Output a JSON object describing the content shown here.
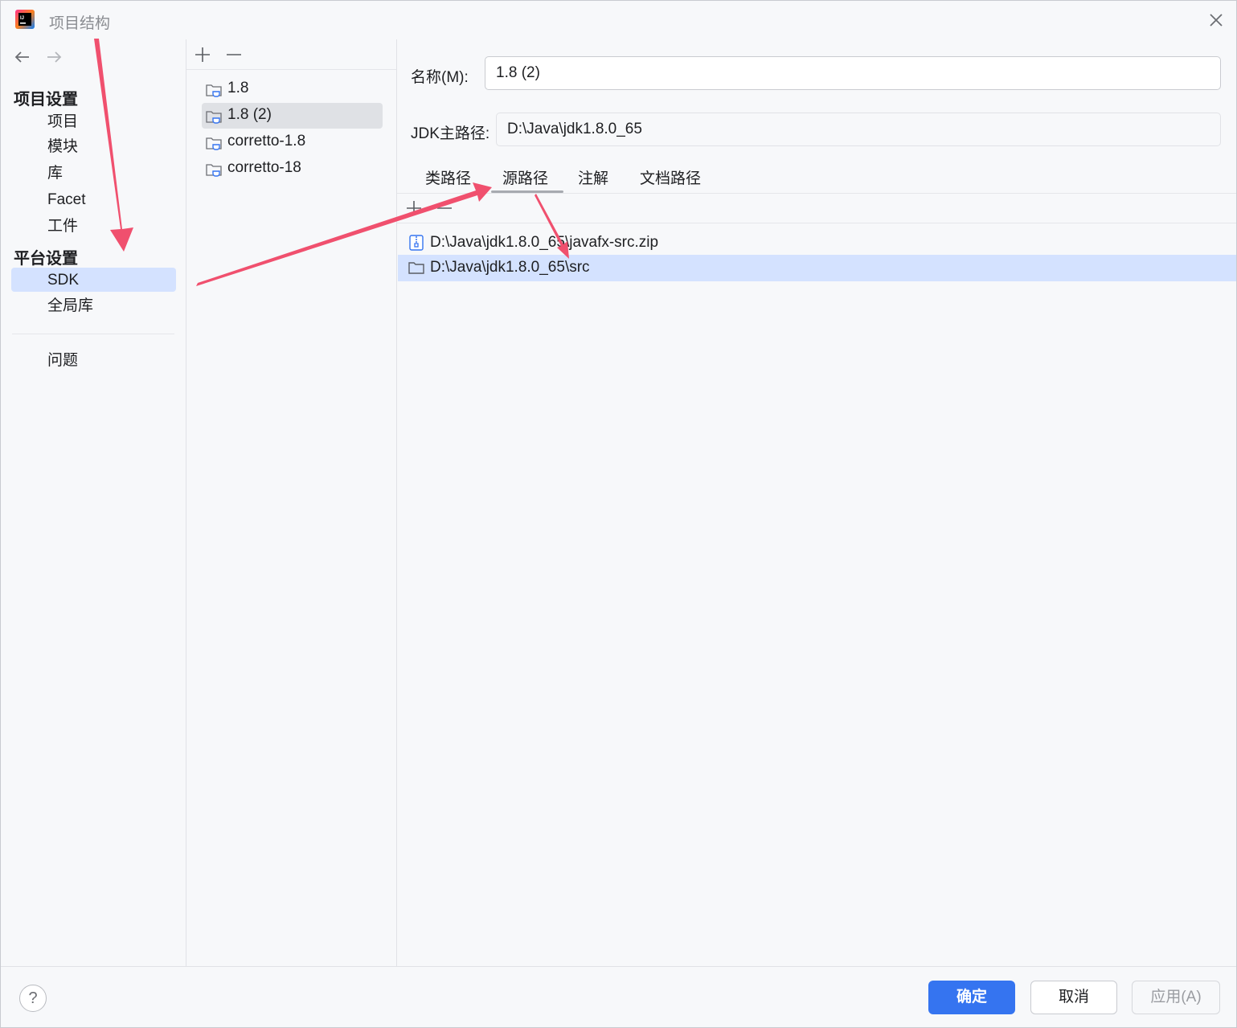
{
  "window": {
    "title": "项目结构"
  },
  "nav": {
    "project_settings": "项目设置",
    "project_items": [
      "项目",
      "模块",
      "库",
      "Facet",
      "工件"
    ],
    "platform_settings": "平台设置",
    "platform_items": [
      "SDK",
      "全局库"
    ],
    "selected": "SDK",
    "problems": "问题"
  },
  "sdks": {
    "items": [
      "1.8",
      "1.8 (2)",
      "corretto-1.8",
      "corretto-18"
    ],
    "selected": "1.8 (2)"
  },
  "detail": {
    "name_label": "名称(M):",
    "name_value": "1.8 (2)",
    "jdk_home_label": "JDK主路径:",
    "jdk_home_value": "D:\\Java\\jdk1.8.0_65",
    "tabs": [
      "类路径",
      "源路径",
      "注解",
      "文档路径"
    ],
    "active_tab": "源路径",
    "paths": [
      "D:\\Java\\jdk1.8.0_65\\javafx-src.zip",
      "D:\\Java\\jdk1.8.0_65\\src"
    ],
    "selected_path": "D:\\Java\\jdk1.8.0_65\\src"
  },
  "footer": {
    "help": "?",
    "ok": "确定",
    "cancel": "取消",
    "apply": "应用(A)"
  },
  "colors": {
    "accent": "#3574f0",
    "selection": "#d4e2ff",
    "annotation_arrow": "#f0506e"
  }
}
